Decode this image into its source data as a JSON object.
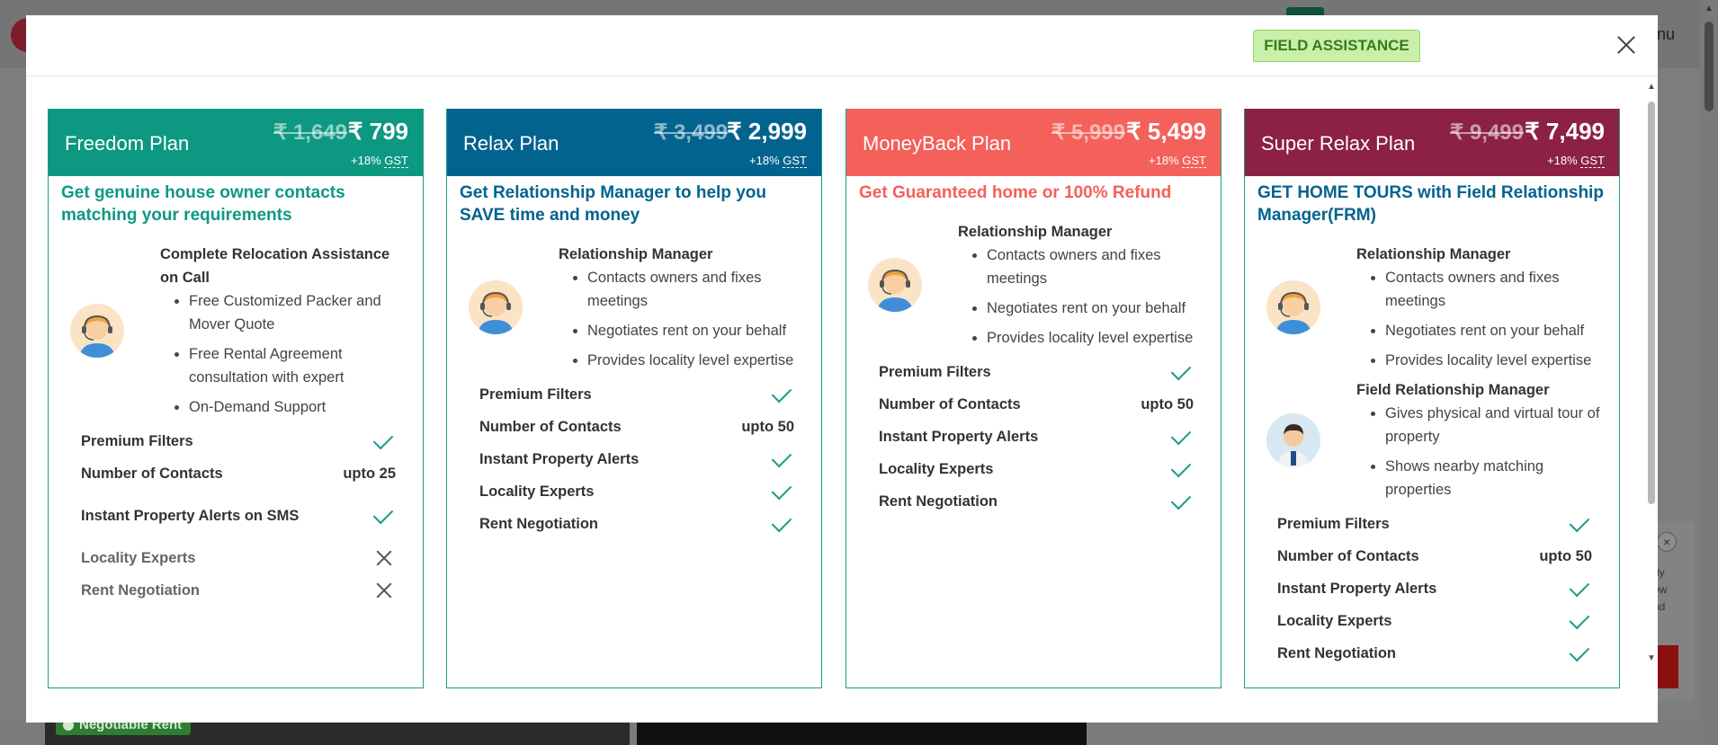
{
  "background": {
    "menu_label": "enu",
    "badge_label": "Negotiable Rent",
    "chat_text": "dy\now\nnd",
    "chat_close": "×"
  },
  "modal": {
    "close_icon": "close-icon",
    "field_assistance_badge": "FIELD ASSISTANCE",
    "plans": [
      {
        "name": "Freedom Plan",
        "color": "#0d9882",
        "tagline_color": "#0d9882",
        "old_price": "₹ 1,649",
        "price": "₹ 799",
        "gst": "+18%",
        "gst_word": "GST",
        "tagline": "Get genuine house owner contacts matching your requirements",
        "features": [
          {
            "title": "Complete Relocation Assistance on Call",
            "avatar": "support-agent-icon",
            "items": [
              "Free Customized Packer and Mover Quote",
              "Free Rental Agreement consultation with expert",
              "On-Demand Support"
            ]
          }
        ],
        "facilities": [
          {
            "label": "Premium Filters",
            "value": "check"
          },
          {
            "label": "Number of Contacts",
            "value": "upto 25"
          },
          {
            "label": "Instant Property Alerts on SMS",
            "value": "check"
          },
          {
            "label": "Locality Experts",
            "value": "cross"
          },
          {
            "label": "Rent Negotiation",
            "value": "cross"
          }
        ]
      },
      {
        "name": "Relax Plan",
        "color": "#02638f",
        "tagline_color": "#02638f",
        "old_price": "₹ 3,499",
        "price": "₹ 2,999",
        "gst": "+18%",
        "gst_word": "GST",
        "tagline": "Get Relationship Manager to help you SAVE time and money",
        "features": [
          {
            "title": "Relationship Manager",
            "avatar": "support-agent-icon",
            "items": [
              "Contacts owners and fixes meetings",
              "Negotiates rent on your behalf",
              "Provides locality level expertise"
            ]
          }
        ],
        "facilities": [
          {
            "label": "Premium Filters",
            "value": "check"
          },
          {
            "label": "Number of Contacts",
            "value": "upto 50"
          },
          {
            "label": "Instant Property Alerts",
            "value": "check"
          },
          {
            "label": "Locality Experts",
            "value": "check"
          },
          {
            "label": "Rent Negotiation",
            "value": "check"
          }
        ]
      },
      {
        "name": "MoneyBack Plan",
        "color": "#f4605a",
        "tagline_color": "#f4605a",
        "old_price": "₹ 5,999",
        "price": "₹ 5,499",
        "gst": "+18%",
        "gst_word": "GST",
        "tagline": "Get Guaranteed home or 100% Refund",
        "features": [
          {
            "title": "Relationship Manager",
            "avatar": "support-agent-icon",
            "items": [
              "Contacts owners and fixes meetings",
              "Negotiates rent on your behalf",
              "Provides locality level expertise"
            ]
          }
        ],
        "facilities": [
          {
            "label": "Premium Filters",
            "value": "check"
          },
          {
            "label": "Number of Contacts",
            "value": "upto 50"
          },
          {
            "label": "Instant Property Alerts",
            "value": "check"
          },
          {
            "label": "Locality Experts",
            "value": "check"
          },
          {
            "label": "Rent Negotiation",
            "value": "check"
          }
        ]
      },
      {
        "name": "Super Relax Plan",
        "color": "#8c2046",
        "tagline_color": "#02638f",
        "old_price": "₹ 9,499",
        "price": "₹ 7,499",
        "gst": "+18%",
        "gst_word": "GST",
        "tagline": "GET HOME TOURS with Field Relationship Manager(FRM)",
        "features": [
          {
            "title": "Relationship Manager",
            "avatar": "support-agent-icon",
            "items": [
              "Contacts owners and fixes meetings",
              "Negotiates rent on your behalf",
              "Provides locality level expertise"
            ]
          },
          {
            "title": "Field Relationship Manager",
            "avatar": "field-manager-icon",
            "items": [
              "Gives physical and virtual tour of property",
              "Shows nearby matching properties"
            ]
          }
        ],
        "facilities": [
          {
            "label": "Premium Filters",
            "value": "check"
          },
          {
            "label": "Number of Contacts",
            "value": "upto 50"
          },
          {
            "label": "Instant Property Alerts",
            "value": "check"
          },
          {
            "label": "Locality Experts",
            "value": "check"
          },
          {
            "label": "Rent Negotiation",
            "value": "check"
          }
        ]
      }
    ]
  }
}
